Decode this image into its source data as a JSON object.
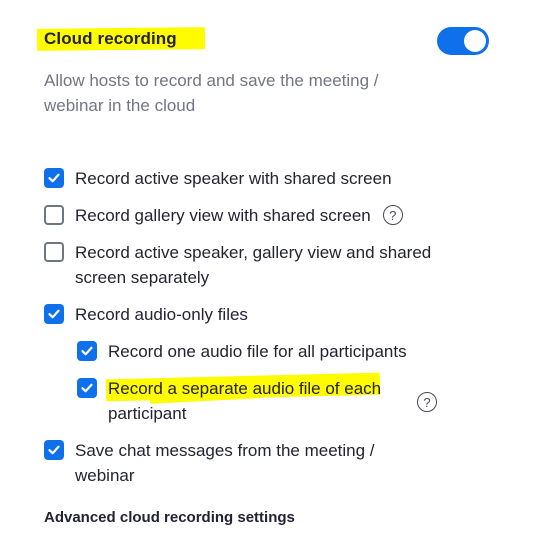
{
  "section": {
    "title": "Cloud recording",
    "enabled": true,
    "description": "Allow hosts to record and save the meeting / webinar in the cloud"
  },
  "options": [
    {
      "id": "active-speaker-shared",
      "line1": "Record active speaker with shared screen",
      "line2": "",
      "checked": true,
      "help": false
    },
    {
      "id": "gallery-shared",
      "line1": "Record gallery view with shared screen",
      "line2": "",
      "checked": false,
      "help": true
    },
    {
      "id": "separately",
      "line1": "Record active speaker, gallery view and shared",
      "line2": "screen separately",
      "checked": false,
      "help": false
    },
    {
      "id": "audio-only",
      "line1": "Record audio-only files",
      "line2": "",
      "checked": true,
      "help": false
    },
    {
      "id": "one-audio",
      "line1": "Record one audio file for all participants",
      "line2": "",
      "checked": true,
      "help": false
    },
    {
      "id": "separate-audio",
      "line1": "Record a separate audio file of each",
      "line2": "participant",
      "checked": true,
      "help": true
    },
    {
      "id": "chat",
      "line1": "Save chat messages from the meeting /",
      "line2": "webinar",
      "checked": true,
      "help": false
    }
  ],
  "help_glyph": "?",
  "advanced_label": "Advanced cloud recording settings",
  "colors": {
    "accent": "#0e71eb",
    "highlight": "#fffb00",
    "description": "#747487"
  }
}
